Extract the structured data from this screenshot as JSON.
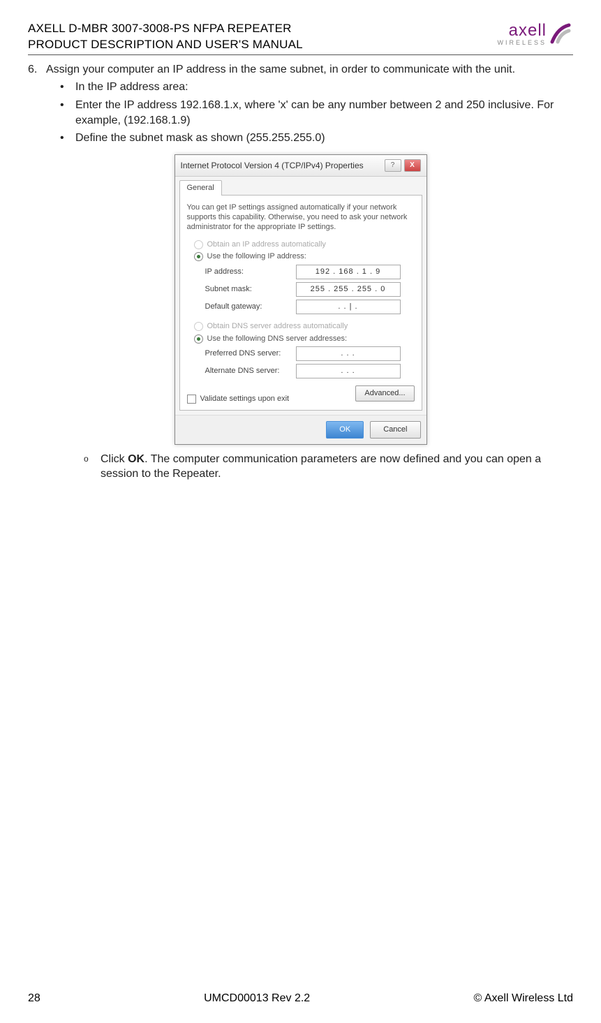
{
  "header": {
    "line1": "AXELL D-MBR 3007-3008-PS NFPA REPEATER",
    "line2": "PRODUCT DESCRIPTION AND USER'S MANUAL",
    "logo_brand": "axell",
    "logo_sub": "WIRELESS"
  },
  "step": {
    "num": "6.",
    "text": "Assign your computer an IP address in the same subnet, in order to communicate with the unit."
  },
  "bullets": [
    "In the IP address area:",
    "Enter the IP address 192.168.1.x, where 'x' can be any number between 2 and 250 inclusive. For example,  (192.168.1.9)",
    "Define the subnet mask as shown (255.255.255.0)"
  ],
  "dialog": {
    "title": "Internet Protocol Version 4 (TCP/IPv4) Properties",
    "help_glyph": "?",
    "close_glyph": "X",
    "tab": "General",
    "intro": "You can get IP settings assigned automatically if your network supports this capability. Otherwise, you need to ask your network administrator for the appropriate IP settings.",
    "radio_auto_ip": "Obtain an IP address automatically",
    "radio_use_ip": "Use the following IP address:",
    "ip_label": "IP address:",
    "ip_value": "192 . 168 .   1  .   9",
    "mask_label": "Subnet mask:",
    "mask_value": "255 . 255 . 255 .   0",
    "gw_label": "Default gateway:",
    "gw_value": ".       .     |   .",
    "radio_auto_dns": "Obtain DNS server address automatically",
    "radio_use_dns": "Use the following DNS server addresses:",
    "pref_dns_label": "Preferred DNS server:",
    "pref_dns_value": ".       .       .",
    "alt_dns_label": "Alternate DNS server:",
    "alt_dns_value": ".       .       .",
    "validate": "Validate settings upon exit",
    "advanced": "Advanced...",
    "ok": "OK",
    "cancel": "Cancel"
  },
  "substep": {
    "marker": "o",
    "prefix": "Click ",
    "bold": "OK",
    "rest": ". The computer communication parameters are now defined and you can open a session to the Repeater."
  },
  "footer": {
    "page": "28",
    "doc": "UMCD00013 Rev 2.2",
    "copyright": "© Axell Wireless Ltd"
  }
}
